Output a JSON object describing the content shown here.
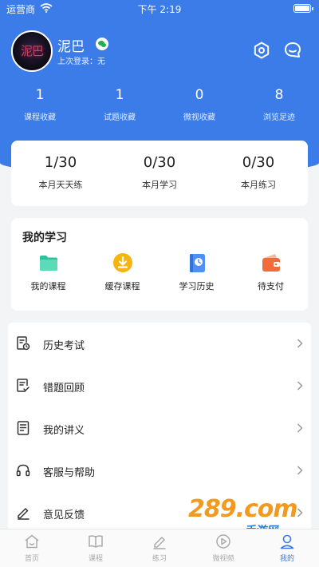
{
  "status_bar": {
    "carrier": "运营商",
    "time": "下午 2:19"
  },
  "profile": {
    "avatar_text": "泥巴",
    "name": "泥巴",
    "last_login": "上次登录：无",
    "social_icon": "wechat-icon"
  },
  "header_actions": {
    "settings_icon": "settings-icon",
    "message_icon": "message-icon"
  },
  "stats": [
    {
      "value": "1",
      "label": "课程收藏"
    },
    {
      "value": "1",
      "label": "试题收藏"
    },
    {
      "value": "0",
      "label": "微视收藏"
    },
    {
      "value": "8",
      "label": "浏览足迹"
    }
  ],
  "monthly": [
    {
      "value": "1/30",
      "label": "本月天天练"
    },
    {
      "value": "0/30",
      "label": "本月学习"
    },
    {
      "value": "0/30",
      "label": "本月练习"
    }
  ],
  "study": {
    "title": "我的学习",
    "items": [
      {
        "label": "我的课程",
        "icon": "folder-icon"
      },
      {
        "label": "缓存课程",
        "icon": "download-icon"
      },
      {
        "label": "学习历史",
        "icon": "history-book-icon"
      },
      {
        "label": "待支付",
        "icon": "wallet-icon"
      }
    ]
  },
  "menu": [
    {
      "label": "历史考试",
      "icon": "exam-history-icon"
    },
    {
      "label": "错题回顾",
      "icon": "wrong-review-icon"
    },
    {
      "label": "我的讲义",
      "icon": "handout-icon"
    },
    {
      "label": "客服与帮助",
      "icon": "headset-icon"
    },
    {
      "label": "意见反馈",
      "icon": "feedback-icon"
    }
  ],
  "watermark": {
    "brand": "289.com",
    "sub": "手游网"
  },
  "tabbar": [
    {
      "label": "首页",
      "icon": "home-icon",
      "active": false
    },
    {
      "label": "课程",
      "icon": "book-icon",
      "active": false
    },
    {
      "label": "练习",
      "icon": "pencil-icon",
      "active": false
    },
    {
      "label": "微视频",
      "icon": "play-icon",
      "active": false
    },
    {
      "label": "我的",
      "icon": "user-icon",
      "active": true
    }
  ],
  "colors": {
    "primary": "#3b7ce8",
    "background": "#f3f4f6",
    "wechat": "#22b14c"
  }
}
